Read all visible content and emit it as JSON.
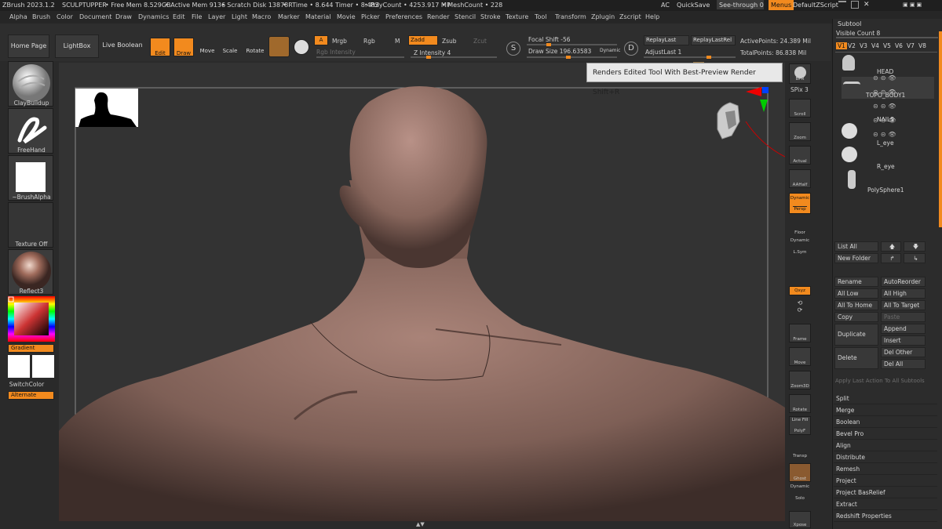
{
  "titlebar": {
    "app": "ZBrush 2023.1.2",
    "doc": "SCULPTUPPER",
    "free_mem": "• Free Mem 8.529GB",
    "active_mem": "• Active Mem 9136",
    "scratch": "• Scratch Disk 13878",
    "rtime": "• RTime • 8.644 Timer • 8.483",
    "polycount": "• PolyCount • 4253.917 MP",
    "meshcount": "• MeshCount • 228",
    "ac": "AC",
    "quicksave": "QuickSave",
    "seethrough": "See-through  0",
    "menus": "Menus",
    "defaultzscript": "DefaultZScript"
  },
  "menubar": [
    "Alpha",
    "Brush",
    "Color",
    "Document",
    "Draw",
    "Dynamics",
    "Edit",
    "File",
    "Layer",
    "Light",
    "Macro",
    "Marker",
    "Material",
    "Movie",
    "Picker",
    "Preferences",
    "Render",
    "Stencil",
    "Stroke",
    "Texture",
    "Tool",
    "Transform",
    "Zplugin",
    "Zscript",
    "Help"
  ],
  "topshelf": {
    "home_page": "Home Page",
    "lightbox": "LightBox",
    "live_boolean": "Live Boolean",
    "edit": "Edit",
    "draw": "Draw",
    "move": "Move",
    "scale": "Scale",
    "rotate": "Rotate",
    "a": "A",
    "mrgb": "Mrgb",
    "rgb": "Rgb",
    "m": "M",
    "zadd": "Zadd",
    "zsub": "Zsub",
    "zcut": "Zcut",
    "rgb_intensity": "Rgb Intensity",
    "z_intensity": "Z Intensity 4",
    "focal_shift": "Focal Shift -56",
    "draw_size": "Draw Size 196.63583",
    "dynamic": "Dynamic",
    "replay_last": "ReplayLast",
    "replay_last_rel": "ReplayLastRel",
    "adjust_last": "AdjustLast 1",
    "active_points": "ActivePoints: 24.389 Mil",
    "total_points": "TotalPoints: 86.838 Mil",
    "s": "S",
    "d": "D"
  },
  "leftshelf": {
    "brush": "ClayBuildup",
    "stroke": "FreeHand",
    "alpha": "~BrushAlpha",
    "texture": "Texture Off",
    "material": "Reflect3",
    "gradient": "Gradient",
    "switchcolor": "SwitchColor",
    "alternate": "Alternate"
  },
  "tooltip": {
    "text": "Renders Edited Tool With Best-Preview Render  Shift+R"
  },
  "rightshelf": {
    "bpr": "BPR",
    "spix": "SPix 3",
    "scroll": "Scroll",
    "zoom": "Zoom",
    "actual": "Actual",
    "aahalf": "AAHalf",
    "dynamic": "Dynamic",
    "persp": "Persp",
    "floor": "Floor",
    "dynamic2": "Dynamic",
    "lsym": "L.Sym",
    "xyz": "Qxyz",
    "frame": "Frame",
    "move": "Move",
    "zoom3d": "Zoom3D",
    "rotate": "Rotate",
    "linefill": "Line Fill",
    "polyf": "PolyF",
    "transp": "Transp",
    "ghost": "Ghost",
    "dynamic3": "Dynamic",
    "solo": "Solo",
    "xpose": "Xpose"
  },
  "subtool": {
    "title": "Subtool",
    "visible_count": "Visible Count 8",
    "versions": [
      "V1",
      "V2",
      "V3",
      "V4",
      "V5",
      "V6",
      "V7",
      "V8"
    ],
    "items": [
      {
        "name": "HEAD"
      },
      {
        "name": "TOPO_BODY1"
      },
      {
        "name": "NAILS"
      },
      {
        "name": "L_eye"
      },
      {
        "name": "R_eye"
      },
      {
        "name": "PolySphere1"
      }
    ],
    "list_all": "List All",
    "new_folder": "New Folder",
    "rename": "Rename",
    "autoreorder": "AutoReorder",
    "all_low": "All Low",
    "all_high": "All High",
    "all_to_home": "All To Home",
    "all_to_target": "All To Target",
    "copy": "Copy",
    "paste": "Paste",
    "append": "Append",
    "duplicate": "Duplicate",
    "insert": "Insert",
    "del_other": "Del Other",
    "delete": "Delete",
    "del_all": "Del All",
    "apply_last": "Apply Last Action To All Subtools",
    "menu": [
      "Split",
      "Merge",
      "Boolean",
      "Bevel Pro",
      "Align",
      "Distribute",
      "Remesh",
      "Project",
      "Project BasRelief",
      "Extract",
      "Redshift Properties"
    ]
  },
  "colors": {
    "accent": "#f28a1e",
    "skin": "#8a6a60",
    "bg": "#333333"
  }
}
